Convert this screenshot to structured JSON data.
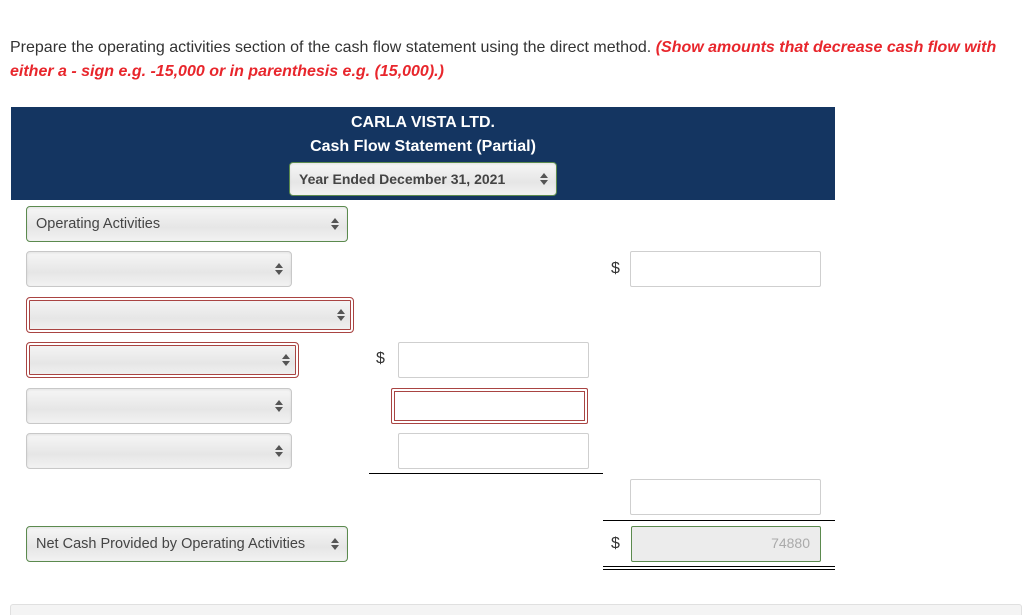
{
  "instructions": {
    "text": "Prepare the operating activities section of the cash flow statement using the direct method.",
    "hint": "(Show amounts that decrease cash flow with either a - sign e.g. -15,000 or in parenthesis e.g. (15,000).)"
  },
  "statement": {
    "company": "CARLA VISTA LTD.",
    "title": "Cash Flow Statement (Partial)",
    "period_select": "Year Ended December 31, 2021"
  },
  "rows": {
    "section_heading_select": "Operating Activities",
    "row1_select": "",
    "row1_input": "",
    "row2_select": "",
    "row3_select": "",
    "row3_input": "",
    "row4_select": "",
    "row4_input": "",
    "row5_select": "",
    "row5_input": "",
    "subtotal_input": "",
    "net_select": "Net Cash Provided by Operating Activities",
    "net_input": "74880"
  },
  "currency_symbol": "$",
  "colors": {
    "header_bg": "#143561",
    "hint_red": "#e8262c",
    "correct_green": "#5b8a4e",
    "incorrect_red": "#a94442"
  }
}
